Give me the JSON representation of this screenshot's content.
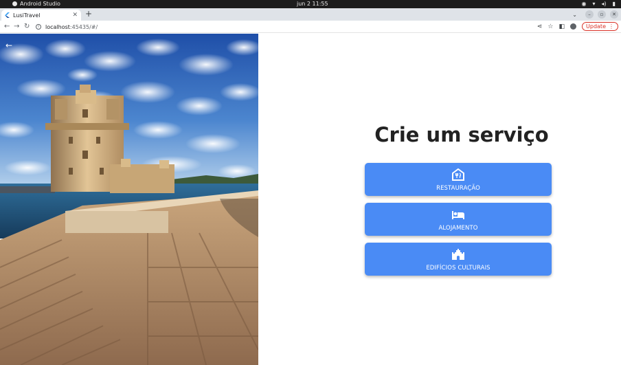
{
  "system_bar": {
    "app_name": "Android Studio",
    "clock": "jun 2  11:55"
  },
  "browser": {
    "tab_title": "LusiTravel",
    "url_host": "localhost",
    "url_path": ":45435/#/",
    "update_label": "Update"
  },
  "page": {
    "heading": "Crie um serviço",
    "services": [
      {
        "label": "RESTAURAÇÃO",
        "icon": "restaurant-icon"
      },
      {
        "label": "ALOJAMENTO",
        "icon": "bed-icon"
      },
      {
        "label": "EDIFÍCIOS CULTURAIS",
        "icon": "castle-icon"
      }
    ]
  },
  "colors": {
    "button_blue": "#4a8bf5",
    "heading": "#222222",
    "update_red": "#d93025"
  }
}
